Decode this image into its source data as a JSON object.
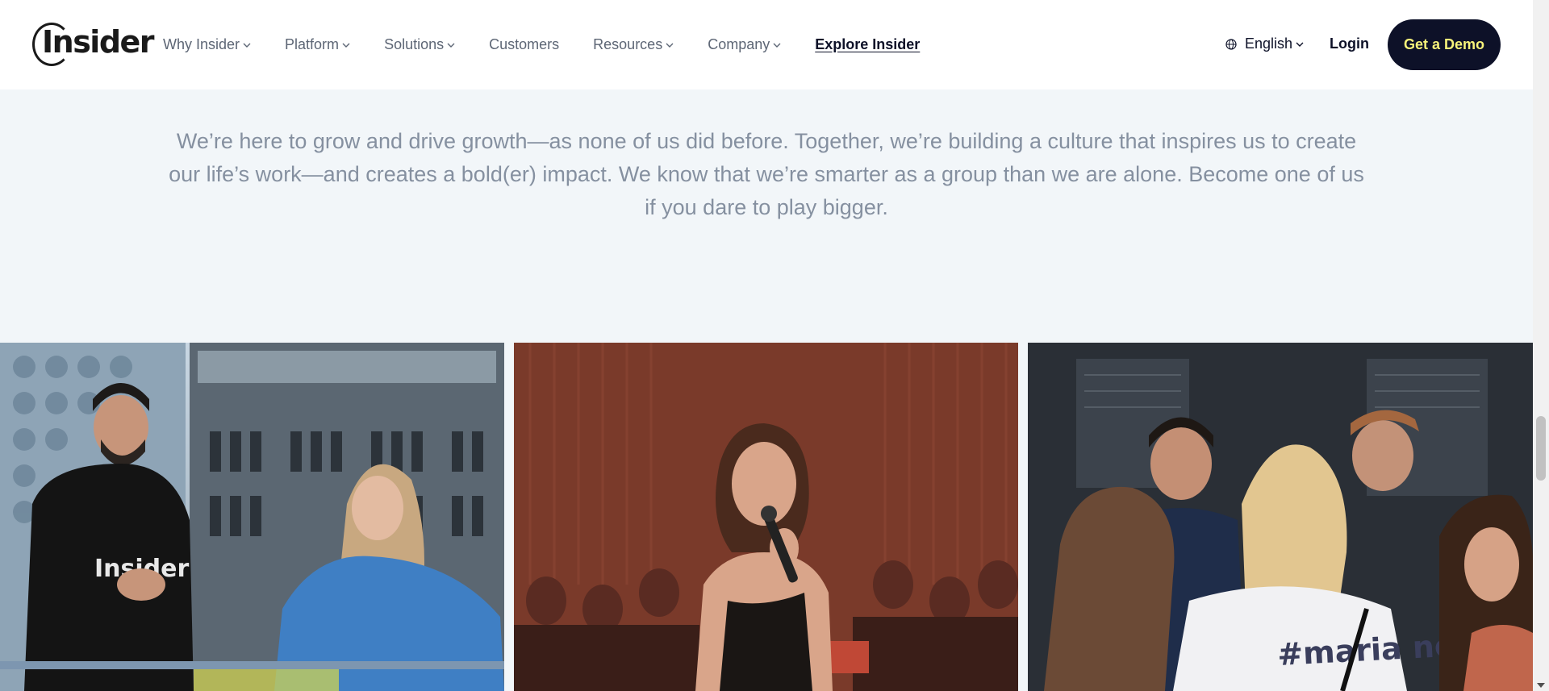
{
  "header": {
    "logo_text": "Insider",
    "nav": [
      {
        "label": "Why Insider",
        "has_dropdown": true
      },
      {
        "label": "Platform",
        "has_dropdown": true
      },
      {
        "label": "Solutions",
        "has_dropdown": true
      },
      {
        "label": "Customers",
        "has_dropdown": false
      },
      {
        "label": "Resources",
        "has_dropdown": true
      },
      {
        "label": "Company",
        "has_dropdown": true
      },
      {
        "label": "Explore Insider",
        "has_dropdown": false
      }
    ],
    "language": "English",
    "login": "Login",
    "cta": "Get a Demo"
  },
  "intro": {
    "text": "We’re here to grow and drive growth—as none of us did before. Together, we’re building a culture that inspires us to create our life’s work—and creates a bold(er) impact. We know that we’re smarter as a group than we are alone. Become one of us if you dare to play bigger."
  },
  "photos": {
    "p1_shirt_text": "Insider",
    "p3_shirt_text": "#maria never"
  },
  "colors": {
    "brand_navy": "#0d1128",
    "cta_text": "#f7f37a",
    "page_bg": "#f2f6f9",
    "nav_text": "#5d6675",
    "intro_text": "#8590a0"
  }
}
